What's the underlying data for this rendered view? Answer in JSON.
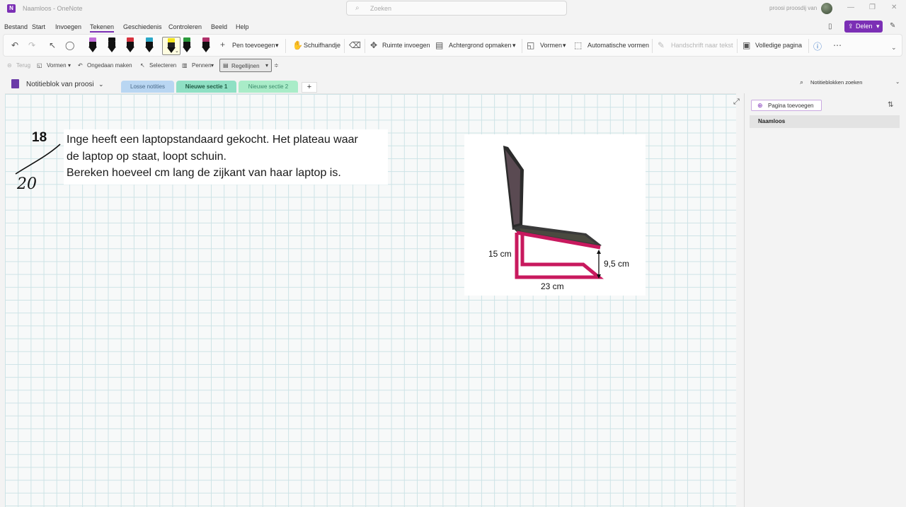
{
  "window": {
    "title": "Naamloos - OneNote",
    "search_placeholder": "Zoeken",
    "user": "proosi proosdij van"
  },
  "menu": [
    "Bestand",
    "Start",
    "Invoegen",
    "Tekenen",
    "Geschiedenis",
    "Controleren",
    "Beeld",
    "Help"
  ],
  "active_menu": "Tekenen",
  "share_label": "Delen",
  "ribbon": {
    "add_pen": "Pen toevoegen",
    "pan": "Schuifhandje",
    "insert_space": "Ruimte invoegen",
    "format_background": "Achtergrond opmaken",
    "shapes": "Vormen",
    "auto_shapes": "Automatische vormen",
    "ink_to_text": "Handschrift naar tekst",
    "full_page": "Volledige pagina",
    "pens": [
      {
        "cap": "#c06bd8"
      },
      {
        "cap": "#111111"
      },
      {
        "cap": "#d8323e"
      },
      {
        "cap": "#2aa8c8"
      },
      {
        "cap": "#f2e41a"
      },
      {
        "cap": "#2a9a3a"
      },
      {
        "cap": "#b0306a"
      }
    ]
  },
  "toolbar2": {
    "back": "Terug",
    "shapes": "Vormen",
    "undo": "Ongedaan maken",
    "select": "Selecteren",
    "pens": "Pennen",
    "rule_lines": "Regellijnen"
  },
  "notebook": {
    "name": "Notitieblok van proosi",
    "tabs": [
      {
        "label": "Losse notities",
        "color": "#b9d6f2"
      },
      {
        "label": "Nieuwe sectie 1",
        "color": "#8fe0c4"
      },
      {
        "label": "Nieuwe sectie 2",
        "color": "#a9ecc8"
      }
    ],
    "active_tab": "Nieuwe sectie 1",
    "search_label": "Notitieblokken zoeken"
  },
  "page": {
    "score_top": "18",
    "score_bottom": "20",
    "question": "Inge heeft een laptopstandaard gekocht. Het plateau waar\nde laptop op staat, loopt schuin.\nBereken hoeveel cm lang de zijkant van haar laptop is.",
    "figure_labels": {
      "height_left": "15 cm",
      "height_right": "9,5 cm",
      "base": "23 cm"
    }
  },
  "side_panel": {
    "add_page": "Pagina toevoegen",
    "pages": [
      "Naamloos"
    ]
  },
  "colors": {
    "accent": "#7b2fb5",
    "stand": "#c8195e"
  }
}
